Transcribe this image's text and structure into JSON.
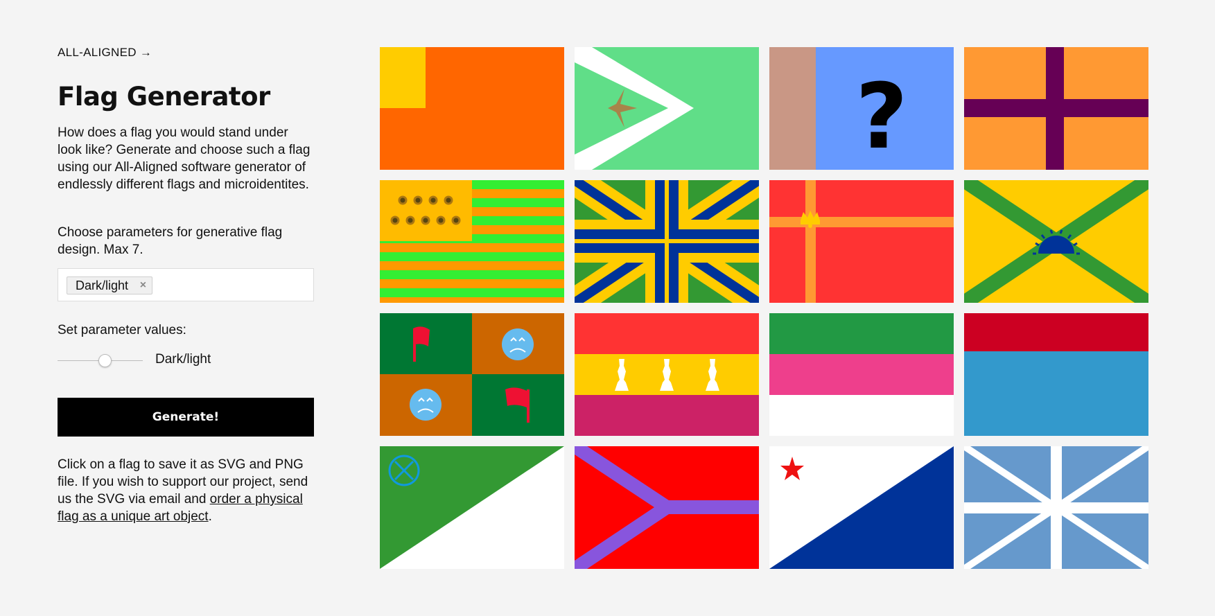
{
  "brand": {
    "label": "ALL-ALIGNED →"
  },
  "title": "Flag Generator",
  "intro": "How does a flag you would stand under look like? Generate and choose such a flag using our All-Aligned software generator of endlessly different flags and microidentites.",
  "choose_text": "Choose parameters for generative flag design. Max 7.",
  "parameters": {
    "selected_tags": [
      {
        "label": "Dark/light",
        "remove_icon": "×"
      }
    ],
    "set_values_label": "Set parameter values:",
    "sliders": [
      {
        "label": "Dark/light",
        "value_fraction": 0.57
      }
    ]
  },
  "generate_button": "Generate!",
  "footer": {
    "text_before": "Click on a flag to save it as SVG and PNG file. If you wish to support our project, send us the SVG via email and ",
    "link_text": "order a physical flag as a unique art object",
    "text_after": "."
  },
  "flags": [
    {
      "name": "flag-orange-canton",
      "colors": [
        "#ff6600",
        "#ffcc00"
      ]
    },
    {
      "name": "flag-green-chevron-star",
      "colors": [
        "#60de88",
        "#ffffff",
        "#a8844a"
      ]
    },
    {
      "name": "flag-blue-question-mark",
      "colors": [
        "#c99785",
        "#6699ff",
        "#000000"
      ]
    },
    {
      "name": "flag-orange-purple-cross",
      "colors": [
        "#ff9933",
        "#660055"
      ]
    },
    {
      "name": "flag-striped-sunflowers",
      "colors": [
        "#ff9900",
        "#33ee33",
        "#ffbb00"
      ]
    },
    {
      "name": "flag-green-yellow-union",
      "colors": [
        "#339933",
        "#ffcc00",
        "#003399"
      ]
    },
    {
      "name": "flag-red-crown-cross",
      "colors": [
        "#ff3333",
        "#ff9933",
        "#ffcc00"
      ]
    },
    {
      "name": "flag-yellow-saltire-sunrise",
      "colors": [
        "#ffcc00",
        "#339933",
        "#003399"
      ]
    },
    {
      "name": "flag-quartered-sad-faces",
      "colors": [
        "#007733",
        "#cc6600",
        "#ee1133",
        "#66bbee"
      ]
    },
    {
      "name": "flag-tricolor-pawns",
      "colors": [
        "#ff3333",
        "#ffcc00",
        "#cc2266",
        "#ffffff"
      ]
    },
    {
      "name": "flag-green-pink-white",
      "colors": [
        "#229944",
        "#ee3f8c",
        "#ffffff"
      ]
    },
    {
      "name": "flag-red-blue",
      "colors": [
        "#cc0022",
        "#3399cc"
      ]
    },
    {
      "name": "flag-green-white-diagonal",
      "colors": [
        "#339933",
        "#ffffff",
        "#1199dd"
      ]
    },
    {
      "name": "flag-red-purple-y",
      "colors": [
        "#ff0000",
        "#8855dd"
      ]
    },
    {
      "name": "flag-white-blue-star",
      "colors": [
        "#ffffff",
        "#003399",
        "#ee1111"
      ]
    },
    {
      "name": "flag-blue-white-union",
      "colors": [
        "#6699cc",
        "#ffffff"
      ]
    }
  ]
}
